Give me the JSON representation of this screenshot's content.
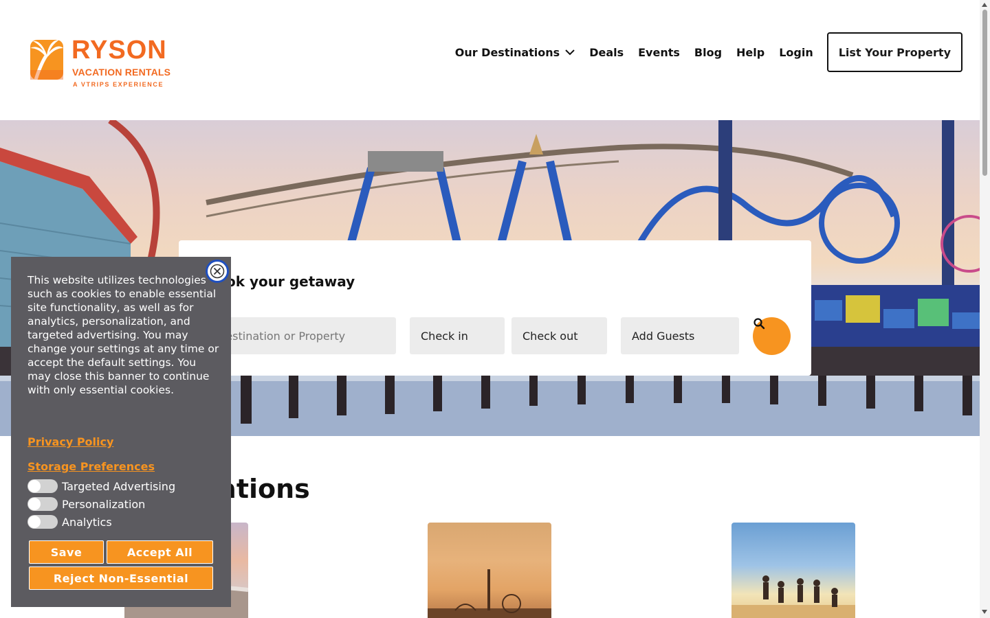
{
  "brand": {
    "name": "RYSON",
    "subtitle": "VACATION RENTALS",
    "tagline": "A VTRIPS EXPERIENCE",
    "color": "#f26a21"
  },
  "nav": {
    "items": [
      {
        "label": "Our Destinations",
        "icon": "chevron-down-icon"
      },
      {
        "label": "Deals"
      },
      {
        "label": "Events"
      },
      {
        "label": "Blog"
      },
      {
        "label": "Help"
      },
      {
        "label": "Login"
      }
    ],
    "cta": "List Your Property"
  },
  "search": {
    "title": "Book your getaway",
    "destination_placeholder": "Destination or Property",
    "check_in": "Check in",
    "check_out": "Check out",
    "guests": "Add Guests",
    "button_color": "#f79420"
  },
  "destinations": {
    "title": "Destinations"
  },
  "cookie_banner": {
    "text": "This website utilizes technologies such as cookies to enable essential site functionality, as well as for analytics, personalization, and targeted advertising. You may change your settings at any time or accept the default settings. You may close this banner to continue with only essential cookies.",
    "privacy_link": "Privacy Policy",
    "storage_link": "Storage Preferences",
    "toggles": [
      {
        "label": "Targeted Advertising",
        "on": false
      },
      {
        "label": "Personalization",
        "on": false
      },
      {
        "label": "Analytics",
        "on": false
      }
    ],
    "save": "Save",
    "accept_all": "Accept All",
    "reject": "Reject Non-Essential",
    "accent": "#f79420"
  }
}
